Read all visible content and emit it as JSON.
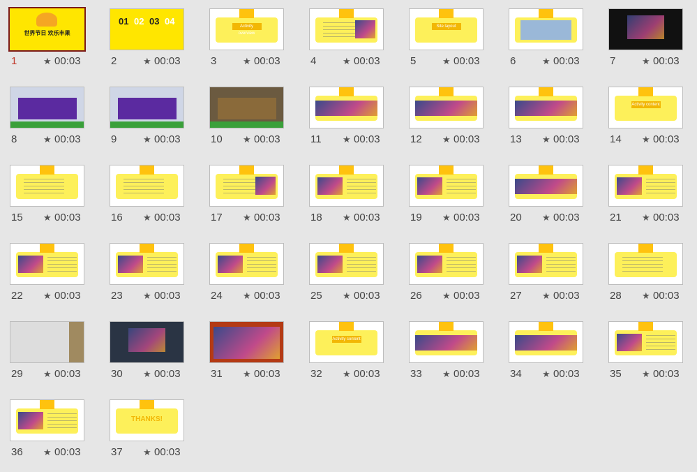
{
  "sorter": {
    "duration_label": "00:03",
    "selected": 1,
    "colors": {
      "background": "#e6e6e6",
      "selection": "#7b1b1b",
      "accent": "#fdf05a"
    },
    "slides": [
      {
        "number": "1",
        "style": "cover",
        "title": "世界节日 欢乐丰果"
      },
      {
        "number": "2",
        "style": "numbers",
        "digits": [
          "01",
          "02",
          "03",
          "04"
        ]
      },
      {
        "number": "3",
        "style": "section",
        "tag": "Activity overview"
      },
      {
        "number": "4",
        "style": "text-photo"
      },
      {
        "number": "5",
        "style": "section",
        "tag": "Site layout"
      },
      {
        "number": "6",
        "style": "plan"
      },
      {
        "number": "7",
        "style": "dark-photo"
      },
      {
        "number": "8",
        "style": "stage"
      },
      {
        "number": "9",
        "style": "stage"
      },
      {
        "number": "10",
        "style": "street"
      },
      {
        "number": "11",
        "style": "photo-strip"
      },
      {
        "number": "12",
        "style": "photo-strip"
      },
      {
        "number": "13",
        "style": "photo-strip"
      },
      {
        "number": "14",
        "style": "section",
        "tag": "Activity content"
      },
      {
        "number": "15",
        "style": "table"
      },
      {
        "number": "16",
        "style": "text"
      },
      {
        "number": "17",
        "style": "text-photo"
      },
      {
        "number": "18",
        "style": "photo-text"
      },
      {
        "number": "19",
        "style": "photo-text"
      },
      {
        "number": "20",
        "style": "photo-strip"
      },
      {
        "number": "21",
        "style": "photo-text"
      },
      {
        "number": "22",
        "style": "photo-text"
      },
      {
        "number": "23",
        "style": "photo-text"
      },
      {
        "number": "24",
        "style": "photo-text"
      },
      {
        "number": "25",
        "style": "photo-text"
      },
      {
        "number": "26",
        "style": "photo-text"
      },
      {
        "number": "27",
        "style": "photo-text"
      },
      {
        "number": "28",
        "style": "text"
      },
      {
        "number": "29",
        "style": "models"
      },
      {
        "number": "30",
        "style": "models-dark"
      },
      {
        "number": "31",
        "style": "red-grid"
      },
      {
        "number": "32",
        "style": "section",
        "tag": "Activity content"
      },
      {
        "number": "33",
        "style": "photo-strip"
      },
      {
        "number": "34",
        "style": "photo-strip"
      },
      {
        "number": "35",
        "style": "photo-text"
      },
      {
        "number": "36",
        "style": "photo-text"
      },
      {
        "number": "37",
        "style": "thanks",
        "tag": "THANKS!"
      }
    ]
  }
}
